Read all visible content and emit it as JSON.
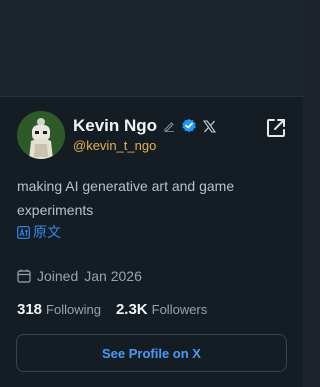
{
  "profile": {
    "name": "Kevin Ngo",
    "handle": "@kevin_t_ngo",
    "bio": "making AI generative art and game experiments",
    "translate_label": "原文",
    "joined_label": "Joined",
    "joined_date": "Jan 2026",
    "following_count": "318",
    "following_label": "Following",
    "followers_count": "2.3K",
    "followers_label": "Followers",
    "see_profile_label": "See Profile on X"
  },
  "icons": {
    "edit": "pencil-icon",
    "verified": "verified-badge-icon",
    "platform": "x-logo-icon",
    "open": "open-external-icon",
    "translate": "translate-icon",
    "calendar": "calendar-icon"
  },
  "colors": {
    "background": "#141c24",
    "handle": "#e8b04a",
    "verified": "#1d9bf0",
    "link": "#2f8cf0"
  }
}
